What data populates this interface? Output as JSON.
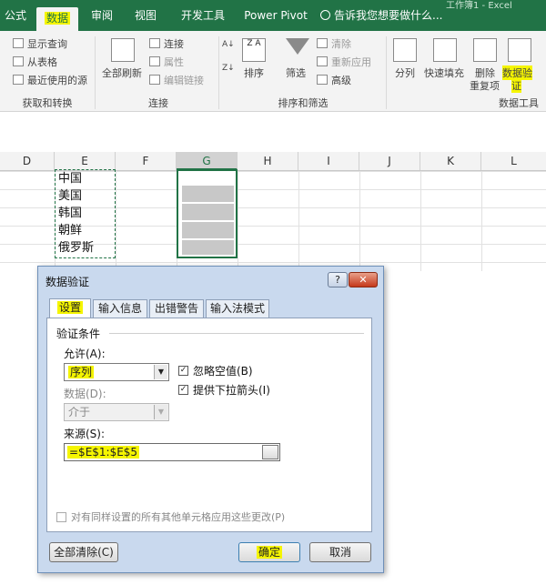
{
  "ribbon": {
    "tabs": [
      "公式",
      "数据",
      "审阅",
      "视图",
      "开发工具",
      "Power Pivot"
    ],
    "active_tab": "数据",
    "tell_me": "告诉我您想要做什么...",
    "window_title_fragment": "工作簿1 - Excel",
    "get_transform": {
      "show_queries": "显示查询",
      "from_table": "从表格",
      "recent_sources": "最近使用的源",
      "group": "获取和转换"
    },
    "connections": {
      "refresh_all": "全部刷新",
      "connections": "连接",
      "properties": "属性",
      "edit_links": "编辑链接",
      "group": "连接"
    },
    "sort_filter": {
      "sort": "排序",
      "filter": "筛选",
      "clear": "清除",
      "reapply": "重新应用",
      "advanced": "高级",
      "group": "排序和筛选"
    },
    "data_tools": {
      "text_to_columns": "分列",
      "flash_fill": "快速填充",
      "remove_duplicates_1": "删除",
      "remove_duplicates_2": "重复项",
      "data_validation_1": "数据验",
      "data_validation_2": "证",
      "group": "数据工具"
    },
    "sort_za": "Z A"
  },
  "sheet": {
    "columns": [
      "D",
      "E",
      "F",
      "G",
      "H",
      "I",
      "J",
      "K",
      "L"
    ],
    "selected_column": "G",
    "e_cells": [
      "中国",
      "美国",
      "韩国",
      "朝鲜",
      "俄罗斯"
    ]
  },
  "dialog": {
    "title": "数据验证",
    "help": "?",
    "close": "✕",
    "tabs": [
      "设置",
      "输入信息",
      "出错警告",
      "输入法模式"
    ],
    "active_tab": "设置",
    "section": "验证条件",
    "allow_label": "允许(A):",
    "allow_value": "序列",
    "ignore_blank": "忽略空值(B)",
    "ignore_blank_checked": true,
    "in_cell_dropdown": "提供下拉箭头(I)",
    "in_cell_dropdown_checked": true,
    "data_label": "数据(D):",
    "data_value": "介于",
    "source_label": "来源(S):",
    "source_value": "=$E$1:$E$5",
    "apply_all": "对有同样设置的所有其他单元格应用这些更改(P)",
    "clear_all": "全部清除(C)",
    "ok": "确定",
    "cancel": "取消"
  },
  "colors": {
    "excel_green": "#217346",
    "highlight": "#f5f500",
    "dialog_frame": "#c9d9ee"
  }
}
